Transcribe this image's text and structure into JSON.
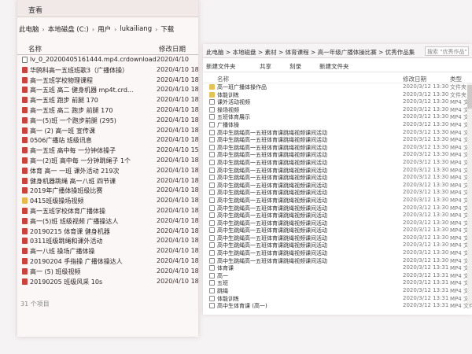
{
  "left": {
    "menu": "查看",
    "breadcrumb": [
      "此电脑",
      "本地磁盘 (C:)",
      "用户",
      "lukailiang",
      "下载"
    ],
    "columns": {
      "name": "名称",
      "modified": "修改日期"
    },
    "files": [
      {
        "name": "lv_0_20200405161444.mp4.crdownload",
        "date": "2020/4/10",
        "icon": "file"
      },
      {
        "name": "华鸥科高一五班班歌3（广播体操）",
        "date": "2020/4/10 18:2",
        "icon": "video"
      },
      {
        "name": "高一五班学校物理课程",
        "date": "2020/4/10 18:2",
        "icon": "video"
      },
      {
        "name": "高一五班 高二 健身机器 mp4t.crd...",
        "date": "2020/4/10 18:2",
        "icon": "video"
      },
      {
        "name": "高一五班 跑步 前腿 170",
        "date": "2020/4/10 18:2",
        "icon": "video"
      },
      {
        "name": "高一五班 高二 跑步 前腿 170",
        "date": "2020/4/10 18:2",
        "icon": "video"
      },
      {
        "name": "高一(5)班 一个跑步前腿 (295)",
        "date": "2020/4/10 18:2",
        "icon": "video"
      },
      {
        "name": "高一 (2) 高一班 宣传课",
        "date": "2020/4/10 18:2",
        "icon": "video"
      },
      {
        "name": "0506广播站 班级讯息",
        "date": "2020/4/10 18:2",
        "icon": "video"
      },
      {
        "name": "高一五班 高中每 一分钟体操子",
        "date": "2020/4/10 15:26",
        "icon": "video"
      },
      {
        "name": "高一(2)班 高中每 一分钟跳绳子 1个",
        "date": "2020/4/10 18:24",
        "icon": "video"
      },
      {
        "name": "体育 高一 一班 课外活动 219次",
        "date": "2020/4/10 18:22",
        "icon": "video"
      },
      {
        "name": "健身机器跳绳 高一八班 四节课",
        "date": "2020/4/10 18:22",
        "icon": "video"
      },
      {
        "name": "2019年广播体操班级比赛",
        "date": "2020/4/10 18:21",
        "icon": "video"
      },
      {
        "name": "0415班级操场视频",
        "date": "2020/4/10 18:21",
        "icon": "folder"
      },
      {
        "name": "高一五班学校体育广播体操",
        "date": "2020/4/10 18:20",
        "icon": "video"
      },
      {
        "name": "高一(5)班 班级视频 广播操达人",
        "date": "2020/4/10 18:20",
        "icon": "video"
      },
      {
        "name": "20190215 体育课 健身机器",
        "date": "2020/4/10 18:19",
        "icon": "video"
      },
      {
        "name": "0311班级跳绳和课外活动",
        "date": "2020/4/10 18:18",
        "icon": "video"
      },
      {
        "name": "高一八班 操场广播体操",
        "date": "2020/4/10 18:17",
        "icon": "video"
      },
      {
        "name": "20190204 手指操 广播体操达人",
        "date": "2020/4/10 18:16",
        "icon": "video"
      },
      {
        "name": "高一 (5) 班级视频",
        "date": "2020/4/10 18:15",
        "icon": "video"
      },
      {
        "name": "20190205 班级风采 10s",
        "date": "2020/4/10 18:14",
        "icon": "video"
      }
    ],
    "status": "31 个项目"
  },
  "right": {
    "path": "此电脑 > 本地磁盘 > 素材 > 体育课程 > 高一年级广播体操比赛 > 优秀作品集",
    "search_placeholder": "搜索 \"优秀作品\"",
    "toolbar": [
      "新建文件夹",
      "共享",
      "刻录",
      "新建文件夹"
    ],
    "columns": {
      "name": "名称",
      "modified": "修改日期",
      "type": "类型"
    },
    "files": [
      {
        "name": "高一班广播体操作品",
        "date": "2020/3/12 13:30",
        "type": "文件夹",
        "icon": "folder"
      },
      {
        "name": "体能训练",
        "date": "2020/3/12 13:30",
        "type": "文件夹",
        "icon": "folder"
      },
      {
        "name": "课外活动视频",
        "date": "2020/3/12 13:30",
        "type": "MP4 文件",
        "icon": "video"
      },
      {
        "name": "操场视频",
        "date": "2020/3/12 13:30",
        "type": "MP4 文件",
        "icon": "video"
      },
      {
        "name": "五班体育展示",
        "date": "2020/3/12 13:30",
        "type": "MP4 文件",
        "icon": "video"
      },
      {
        "name": "广播体操",
        "date": "2020/3/12 13:30",
        "type": "MP4 文件",
        "icon": "video"
      },
      {
        "name": "高中生跳绳高一五班体育课跳绳视频课间活动",
        "date": "2020/3/12 13:30",
        "type": "MP4 文件",
        "icon": "video"
      },
      {
        "name": "高中生跳绳高一五班体育课跳绳视频课间活动",
        "date": "2020/3/12 13:30",
        "type": "MP4 文件",
        "icon": "video"
      },
      {
        "name": "高中生跳绳高一五班体育课跳绳视频课间活动",
        "date": "2020/3/12 13:30",
        "type": "MP4 文件",
        "icon": "video"
      },
      {
        "name": "高中生跳绳高一五班体育课跳绳视频课间活动",
        "date": "2020/3/12 13:30",
        "type": "MP4 文件",
        "icon": "video"
      },
      {
        "name": "高中生跳绳高一五班体育课跳绳视频课间活动",
        "date": "2020/3/12 13:30",
        "type": "MP4 文件",
        "icon": "video"
      },
      {
        "name": "高中生跳绳高一五班体育课跳绳视频课间活动",
        "date": "2020/3/12 13:30",
        "type": "MP4 文件",
        "icon": "video"
      },
      {
        "name": "高中生跳绳高一五班体育课跳绳视频课间活动",
        "date": "2020/3/12 13:30",
        "type": "MP4 文件",
        "icon": "video"
      },
      {
        "name": "高中生跳绳高一五班体育课跳绳视频课间活动",
        "date": "2020/3/12 13:30",
        "type": "MP4 文件",
        "icon": "video"
      },
      {
        "name": "高中生跳绳高一五班体育课跳绳视频课间活动",
        "date": "2020/3/12 13:30",
        "type": "MP4 文件",
        "icon": "video"
      },
      {
        "name": "高中生跳绳高一五班体育课跳绳视频课间活动",
        "date": "2020/3/12 13:30",
        "type": "MP4 文件",
        "icon": "video"
      },
      {
        "name": "高中生跳绳高一五班体育课跳绳视频课间活动",
        "date": "2020/3/12 13:30",
        "type": "MP4 文件",
        "icon": "video"
      },
      {
        "name": "高中生跳绳高一五班体育课跳绳视频课间活动",
        "date": "2020/3/12 13:30",
        "type": "MP4 文件",
        "icon": "video"
      },
      {
        "name": "高中生跳绳高一五班体育课跳绳视频课间活动",
        "date": "2020/3/12 13:30",
        "type": "MP4 文件",
        "icon": "video"
      },
      {
        "name": "高中生跳绳高一五班体育课跳绳视频课间活动",
        "date": "2020/3/12 13:30",
        "type": "MP4 文件",
        "icon": "video"
      },
      {
        "name": "高中生跳绳高一五班体育课跳绳视频课间活动",
        "date": "2020/3/12 13:30",
        "type": "MP4 文件",
        "icon": "video"
      },
      {
        "name": "高中生跳绳高一五班体育课跳绳视频课间活动",
        "date": "2020/3/12 13:30",
        "type": "MP4 文件",
        "icon": "video"
      },
      {
        "name": "高中生跳绳高一五班体育课跳绳视频课间活动",
        "date": "2020/3/12 13:30",
        "type": "MP4 文件",
        "icon": "video"
      },
      {
        "name": "高中生跳绳高一五班体育课跳绳视频课间活动",
        "date": "2020/3/12 13:30",
        "type": "MP4 文件",
        "icon": "video"
      },
      {
        "name": "体育课",
        "date": "2020/3/12 13:31",
        "type": "MP4 文件",
        "icon": "video"
      },
      {
        "name": "高一",
        "date": "2020/3/12 13:31",
        "type": "MP4 文件",
        "icon": "video"
      },
      {
        "name": "五班",
        "date": "2020/3/12 13:31",
        "type": "MP4 文件",
        "icon": "video"
      },
      {
        "name": "跳绳",
        "date": "2020/3/12 13:31",
        "type": "MP4 文件",
        "icon": "video"
      },
      {
        "name": "体能训练",
        "date": "2020/3/12 13:31",
        "type": "MP4 文件",
        "icon": "video"
      },
      {
        "name": "高中生体育课 (高一)",
        "date": "2020/3/12 13:31",
        "type": "MP4 文件",
        "icon": "video"
      }
    ]
  },
  "colors": {
    "background": "#f6f3f5",
    "video_icon": "#c8443c",
    "folder_icon": "#e6b94b"
  }
}
